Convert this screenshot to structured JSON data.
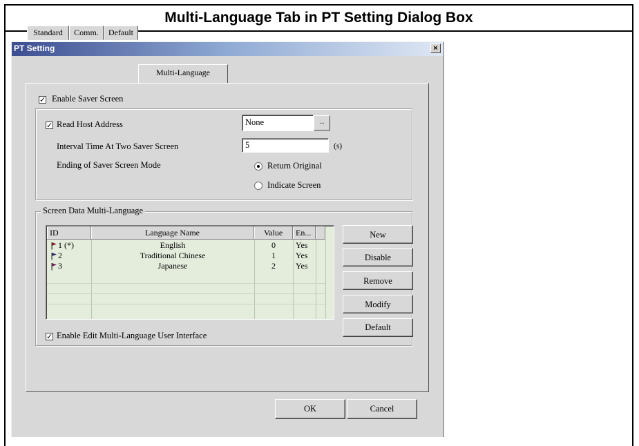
{
  "caption": "Multi-Language Tab in PT Setting Dialog Box",
  "dialog": {
    "title": "PT Setting",
    "close_glyph": "×",
    "tabs": [
      "Standard",
      "Comm.",
      "Default",
      "Multi-Language"
    ],
    "active_tab": "Multi-Language"
  },
  "saver": {
    "enable_label": "Enable Saver Screen",
    "enable_checked": true,
    "read_host_label": "Read Host Address",
    "read_host_checked": true,
    "host_value": "None",
    "browse_label": "...",
    "interval_label": "Interval Time At Two Saver Screen",
    "interval_value": "5",
    "interval_unit": "(s)",
    "ending_label": "Ending of Saver Screen Mode",
    "option_return": "Return Original",
    "option_indicate": "Indicate Screen",
    "selected_option": "Return Original"
  },
  "multilang": {
    "group_title": "Screen Data Multi-Language",
    "columns": [
      "ID",
      "Language Name",
      "Value",
      "En..."
    ],
    "rows": [
      {
        "id": "1 (*)",
        "name": "English",
        "value": "0",
        "enabled": "Yes",
        "flag_color": "#8b1a2a"
      },
      {
        "id": "2",
        "name": "Traditional Chinese",
        "value": "1",
        "enabled": "Yes",
        "flag_color": "#2a2a6e"
      },
      {
        "id": "3",
        "name": "Japanese",
        "value": "2",
        "enabled": "Yes",
        "flag_color": "#7a1a5a"
      }
    ],
    "buttons": {
      "new": "New",
      "disable": "Disable",
      "remove": "Remove",
      "modify": "Modify",
      "default": "Default"
    },
    "edit_ui_label": "Enable Edit Multi-Language User Interface",
    "edit_ui_checked": true
  },
  "footer": {
    "ok": "OK",
    "cancel": "Cancel"
  },
  "colors": {
    "title_bar_start": "#3d4e91",
    "dialog_face": "#d8d8d8",
    "table_background": "#e4ecdc"
  }
}
